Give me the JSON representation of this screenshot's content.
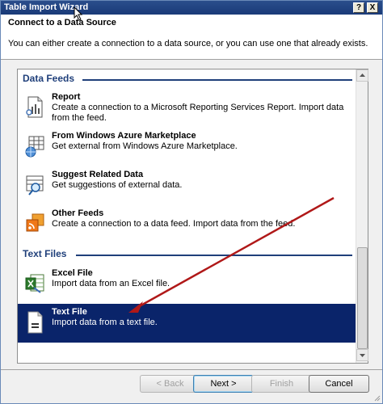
{
  "window": {
    "title": "Table Import Wizard",
    "help_label": "?",
    "close_label": "X"
  },
  "header": {
    "title": "Connect to a Data Source",
    "description": "You can either create a connection to a data source, or you can use one that already exists."
  },
  "groups": [
    {
      "label": "Data Feeds",
      "items": [
        {
          "name": "Report",
          "description": "Create a connection to a Microsoft Reporting Services Report. Import data from the feed.",
          "icon": "report-icon"
        },
        {
          "name": "From Windows Azure Marketplace",
          "description": "Get external from Windows Azure Marketplace.",
          "icon": "azure-marketplace-icon"
        },
        {
          "name": "Suggest Related Data",
          "description": "Get suggestions of external data.",
          "icon": "suggest-data-icon"
        },
        {
          "name": "Other Feeds",
          "description": "Create a connection to a data feed. Import data from the feed.",
          "icon": "other-feeds-icon"
        }
      ]
    },
    {
      "label": "Text Files",
      "items": [
        {
          "name": "Excel File",
          "description": "Import data from an Excel file.",
          "icon": "excel-icon"
        },
        {
          "name": "Text File",
          "description": "Import data from a text file.",
          "icon": "text-file-icon",
          "selected": true
        }
      ]
    }
  ],
  "buttons": {
    "back": "< Back",
    "next": "Next >",
    "finish": "Finish",
    "cancel": "Cancel"
  },
  "colors": {
    "selection": "#0a246a",
    "group_header": "#1f3f7a",
    "annotation_arrow": "#b01818"
  }
}
